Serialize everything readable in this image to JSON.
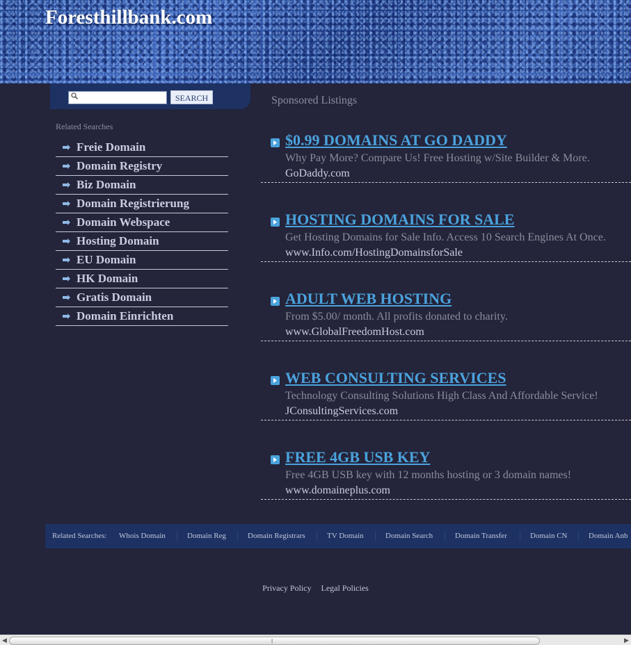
{
  "header": {
    "title": "Foresthillbank.com"
  },
  "search": {
    "placeholder": "",
    "value": "",
    "button_label": "SEARCH"
  },
  "related": {
    "title": "Related Searches",
    "items": [
      "Freie Domain",
      "Domain Registry",
      "Biz Domain",
      "Domain Registrierung",
      "Domain Webspace",
      "Hosting Domain",
      "EU Domain",
      "HK Domain",
      "Gratis Domain",
      "Domain Einrichten"
    ]
  },
  "sponsored": {
    "title": "Sponsored Listings",
    "listings": [
      {
        "headline": "$0.99 DOMAINS AT GO DADDY",
        "desc": "Why Pay More? Compare Us! Free Hosting w/Site Builder & More.",
        "url": "GoDaddy.com"
      },
      {
        "headline": "HOSTING DOMAINS FOR SALE",
        "desc": "Get Hosting Domains for Sale Info. Access 10 Search Engines At Once.",
        "url": "www.Info.com/HostingDomainsforSale"
      },
      {
        "headline": "ADULT WEB HOSTING",
        "desc": "From $5.00/ month. All profits donated to charity.",
        "url": "www.GlobalFreedomHost.com"
      },
      {
        "headline": "WEB CONSULTING SERVICES",
        "desc": "Technology Consulting Solutions High Class And Affordable Service!",
        "url": "JConsultingServices.com"
      },
      {
        "headline": "FREE 4GB USB KEY",
        "desc": "Free 4GB USB key with 12 months hosting or 3 domain names!",
        "url": "www.domaineplus.com"
      }
    ]
  },
  "footer": {
    "label": "Related Searches:",
    "links": [
      "Whois Domain",
      "Domain Reg",
      "Domain Registrars",
      "TV Domain",
      "Domain Search",
      "Domain Transfer",
      "Domain CN",
      "Domain Anb"
    ]
  },
  "bottom": {
    "privacy": "Privacy Policy",
    "legal": "Legal Policies"
  },
  "colors": {
    "background": "#24243a",
    "accent": "#4aa3dd",
    "panel": "#1d3163"
  }
}
